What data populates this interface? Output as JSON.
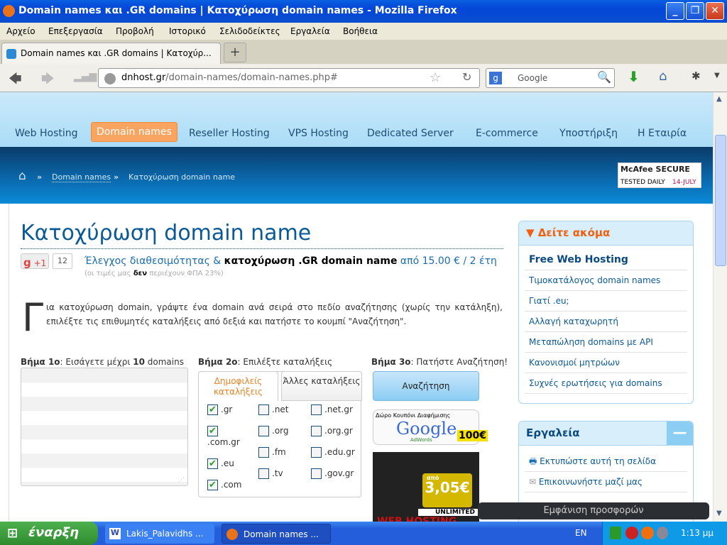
{
  "window": {
    "title": "Domain names και .GR domains | Κατοχύρωση domain names - Mozilla Firefox"
  },
  "menu": [
    "Αρχείο",
    "Επεξεργασία",
    "Προβολή",
    "Ιστορικό",
    "Σελιδοδείκτες",
    "Εργαλεία",
    "Βοήθεια"
  ],
  "tab": {
    "label": "Domain names και .GR domains | Κατοχύρ...",
    "new": "+"
  },
  "url": {
    "host": "dnhost.gr",
    "path": "/domain-names/domain-names.php#"
  },
  "search": {
    "placeholder": "Google"
  },
  "site_nav": [
    "Web Hosting",
    "Domain names",
    "Reseller Hosting",
    "VPS Hosting",
    "Dedicated Server",
    "E-commerce",
    "Υποστήριξη",
    "Η Εταιρία"
  ],
  "breadcrumb": {
    "sep": "»",
    "link": "Domain names",
    "current": "Κατοχύρωση domain name"
  },
  "mcafee": {
    "brand": "McAfee SECURE",
    "tested": "TESTED DAILY",
    "date": "14-JULY"
  },
  "main": {
    "title": "Κατοχύρωση domain name",
    "gplus": "+1",
    "gcount": "12",
    "sub1": "Έλεγχος διαθεσιμότητας & ",
    "sub_bold": "κατοχύρωση .GR domain name",
    "sub2": " από 15.00 € / 2 έτη",
    "vat1": "(οι τιμές μας ",
    "vat_bold": "δεν",
    "vat2": " περιέχουν ΦΠΑ 23%)",
    "dropcap": "Γ",
    "intro": "ια κατοχύρωση domain, γράψτε ένα domain ανά σειρά στο πεδίο αναζήτησης (χωρίς την κατάληξη), επιλέξτε τις επιθυμητές καταλήξεις από δεξιά και πατήστε το κουμπί \"Αναζήτηση\".",
    "step1_b": "Βήμα 1ο",
    "step1": ": Εισάγετε μέχρι ",
    "step1_n": "10",
    "step1_e": " domains",
    "step2_b": "Βήμα 2ο",
    "step2": ": Επιλέξτε καταλήξεις",
    "step3_b": "Βήμα 3ο",
    "step3": ": Πατήστε Αναζήτηση!",
    "tab_popular": "Δημοφιλείς καταλήξεις",
    "tab_other": "Άλλες καταλήξεις",
    "tlds": [
      {
        "n": ".gr",
        "c": true
      },
      {
        "n": ".com.gr",
        "c": true
      },
      {
        "n": ".eu",
        "c": true
      },
      {
        "n": ".com",
        "c": true
      },
      {
        "n": ".net",
        "c": false
      },
      {
        "n": ".org",
        "c": false
      },
      {
        "n": ".fm",
        "c": false
      },
      {
        "n": ".tv",
        "c": false
      },
      {
        "n": ".net.gr",
        "c": false
      },
      {
        "n": ".org.gr",
        "c": false
      },
      {
        "n": ".edu.gr",
        "c": false
      },
      {
        "n": ".gov.gr",
        "c": false
      }
    ],
    "search_btn": "Αναζήτηση",
    "ad_title": "Δώρο Κουπόνι Διαφήμισης",
    "ad_google": "Google",
    "ad_adwords": "AdWords",
    "ad_amount": "100€",
    "ad2_from": "από",
    "ad2_price": "3,05€",
    "ad2_unl": "UNLIMITED",
    "ad2_web": "WEB HOSTING"
  },
  "sidebar": {
    "see_more": "Δείτε ακόμα",
    "links": [
      "Free Web Hosting",
      "Τιμοκατάλογος domain names",
      "Γιατί .eu;",
      "Αλλαγή καταχωρητή",
      "Μεταπώληση domains με API",
      "Κανονισμοί μητρώων",
      "Συχνές ερωτήσεις για domains"
    ],
    "tools": "Εργαλεία",
    "tool_links": [
      "Εκτυπώστε αυτή τη σελίδα",
      "Επικοινωνήστε μαζί μας"
    ]
  },
  "offers": "Εμφάνιση προσφορών",
  "taskbar": {
    "start": "έναρξη",
    "items": [
      "Lakis_Palavidhs ...",
      "Domain names ..."
    ],
    "lang": "EN",
    "clock": "1:13 μμ"
  }
}
